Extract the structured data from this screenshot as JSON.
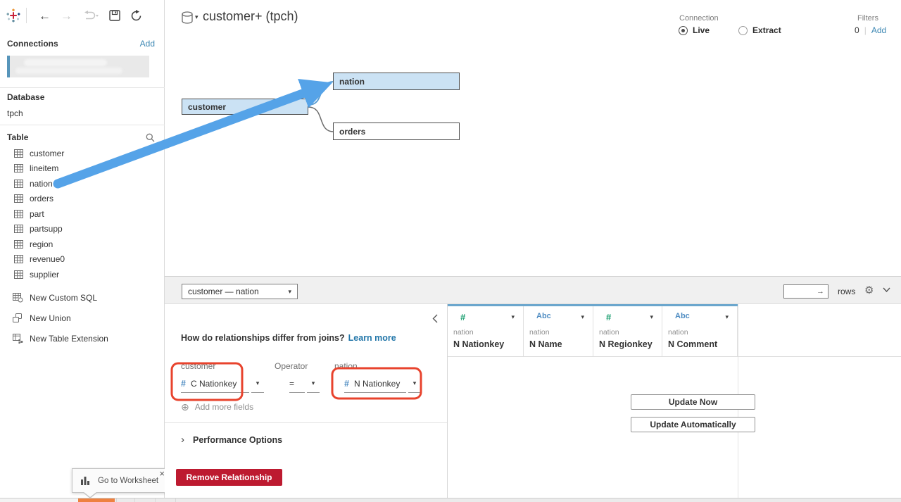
{
  "app": {
    "title": "customer+ (tpch)"
  },
  "sidebar": {
    "connections_label": "Connections",
    "add_label": "Add",
    "database_label": "Database",
    "database_name": "tpch",
    "table_label": "Table",
    "tables": [
      "customer",
      "lineitem",
      "nation",
      "orders",
      "part",
      "partsupp",
      "region",
      "revenue0",
      "supplier"
    ],
    "actions": [
      "New Custom SQL",
      "New Union",
      "New Table Extension"
    ]
  },
  "header": {
    "connection_label": "Connection",
    "live_label": "Live",
    "extract_label": "Extract",
    "filters_label": "Filters",
    "filters_count": "0",
    "filters_add": "Add"
  },
  "canvas": {
    "customer": "customer",
    "nation": "nation",
    "orders": "orders"
  },
  "relationship_bar": {
    "pair_label": "customer — nation",
    "rows_label": "rows"
  },
  "relationship_panel": {
    "question": "How do relationships differ from joins?",
    "learn_more": "Learn more",
    "left_table_label": "customer",
    "operator_label": "Operator",
    "right_table_label": "nation",
    "left_field_type": "#",
    "left_field": "C Nationkey",
    "operator_value": "=",
    "right_field_type": "#",
    "right_field": "N Nationkey",
    "add_more_label": "Add more fields",
    "performance_label": "Performance Options",
    "remove_label": "Remove Relationship"
  },
  "data_grid": {
    "columns": [
      {
        "type_label": "#",
        "table": "nation",
        "field": "N Nationkey"
      },
      {
        "type_label": "Abc",
        "table": "nation",
        "field": "N Name"
      },
      {
        "type_label": "#",
        "table": "nation",
        "field": "N Regionkey"
      },
      {
        "type_label": "Abc",
        "table": "nation",
        "field": "N Comment"
      }
    ],
    "update_now_label": "Update Now",
    "update_auto_label": "Update Automatically"
  },
  "tooltip": {
    "label": "Go to Worksheet"
  },
  "icons": {
    "back_arrow": "←",
    "forward_arrow": "→",
    "caret_down": "▾",
    "gear": "⚙",
    "go_arrow": "→",
    "close": "×",
    "add_circle": "⊕",
    "chevron_right": "›",
    "pipe": "|"
  },
  "colors": {
    "annotation_arrow_blue": "#55a3e8",
    "annotation_red": "#e8432d",
    "selected_table_fill": "#cbe2f4",
    "remove_button_red": "#bd1a30",
    "active_sheet_tab_orange": "#ee8140",
    "link_blue": "#2276a9",
    "grid_header_accent": "#6ba6cd"
  }
}
